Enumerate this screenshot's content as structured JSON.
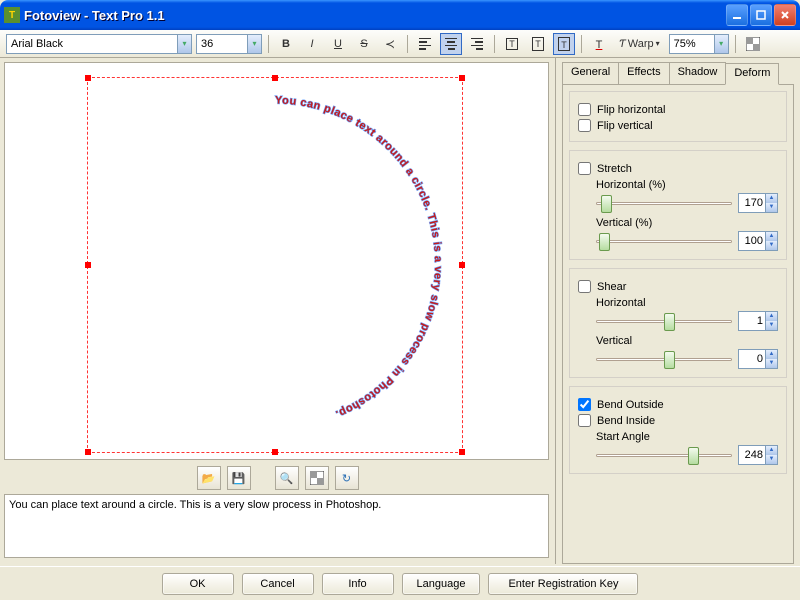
{
  "window": {
    "title": "Fotoview - Text Pro 1.1"
  },
  "toolbar": {
    "font": "Arial Black",
    "size": "36",
    "warp_label": "Warp",
    "zoom": "75%"
  },
  "canvas": {
    "text": "You can place text around a circle.  This is a very slow process in Photoshop.  "
  },
  "textarea": {
    "value": "You can place text around a circle. This is a very slow process in Photoshop."
  },
  "tabs": {
    "general": "General",
    "effects": "Effects",
    "shadow": "Shadow",
    "deform": "Deform"
  },
  "deform": {
    "flip_h": {
      "label": "Flip horizontal",
      "checked": false
    },
    "flip_v": {
      "label": "Flip vertical",
      "checked": false
    },
    "stretch": {
      "label": "Stretch",
      "checked": false,
      "h_label": "Horizontal (%)",
      "h_value": "170",
      "v_label": "Vertical (%)",
      "v_value": "100"
    },
    "shear": {
      "label": "Shear",
      "checked": false,
      "h_label": "Horizontal",
      "h_value": "1",
      "v_label": "Vertical",
      "v_value": "0"
    },
    "bend_outside": {
      "label": "Bend Outside",
      "checked": true
    },
    "bend_inside": {
      "label": "Bend Inside",
      "checked": false
    },
    "start_angle": {
      "label": "Start Angle",
      "value": "248"
    }
  },
  "buttons": {
    "ok": "OK",
    "cancel": "Cancel",
    "info": "Info",
    "language": "Language",
    "register": "Enter Registration Key"
  }
}
